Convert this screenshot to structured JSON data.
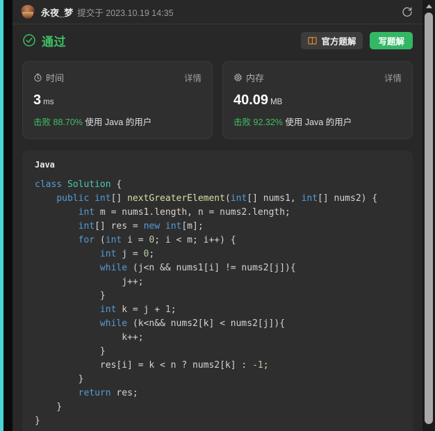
{
  "header": {
    "user_name": "永夜_梦",
    "submit_meta": "提交于 2023.10.19 14:35",
    "refresh_icon": "refresh-icon",
    "avatar_icon": "user-avatar"
  },
  "status": {
    "check_icon": "check-circle-icon",
    "text": "通过",
    "official_button": "官方题解",
    "official_icon": "book-icon",
    "write_button": "写题解",
    "accent_green": "#34b765",
    "status_green": "#3fbf62",
    "book_orange": "#e08b2c"
  },
  "stats": [
    {
      "icon": "clock-icon",
      "label": "时间",
      "detail_link": "详情",
      "value": "3",
      "unit": "ms",
      "beat_prefix": "击败",
      "beat_percent": "88.70%",
      "beat_suffix": "使用 Java 的用户"
    },
    {
      "icon": "memory-chip-icon",
      "label": "内存",
      "detail_link": "详情",
      "value": "40.09",
      "unit": "MB",
      "beat_prefix": "击败",
      "beat_percent": "92.32%",
      "beat_suffix": "使用 Java 的用户"
    }
  ],
  "code": {
    "language_label": "Java",
    "lines": [
      [
        [
          "k",
          "class "
        ],
        [
          "ty",
          "Solution"
        ],
        [
          "pl",
          " {"
        ]
      ],
      [
        [
          "pl",
          "    "
        ],
        [
          "k",
          "public "
        ],
        [
          "k",
          "int"
        ],
        [
          "pl",
          "[] "
        ],
        [
          "fn",
          "nextGreaterElement"
        ],
        [
          "pl",
          "("
        ],
        [
          "k",
          "int"
        ],
        [
          "pl",
          "[] nums1, "
        ],
        [
          "k",
          "int"
        ],
        [
          "pl",
          "[] nums2) {"
        ]
      ],
      [
        [
          "pl",
          "        "
        ],
        [
          "k",
          "int"
        ],
        [
          "pl",
          " m = nums1.length, n = nums2.length;"
        ]
      ],
      [
        [
          "pl",
          "        "
        ],
        [
          "k",
          "int"
        ],
        [
          "pl",
          "[] res = "
        ],
        [
          "k",
          "new "
        ],
        [
          "k",
          "int"
        ],
        [
          "pl",
          "[m];"
        ]
      ],
      [
        [
          "pl",
          "        "
        ],
        [
          "k",
          "for"
        ],
        [
          "pl",
          " ("
        ],
        [
          "k",
          "int"
        ],
        [
          "pl",
          " i = "
        ],
        [
          "nu",
          "0"
        ],
        [
          "pl",
          "; i < m; i++) {"
        ]
      ],
      [
        [
          "pl",
          "            "
        ],
        [
          "k",
          "int"
        ],
        [
          "pl",
          " j = "
        ],
        [
          "nu",
          "0"
        ],
        [
          "pl",
          ";"
        ]
      ],
      [
        [
          "pl",
          "            "
        ],
        [
          "k",
          "while"
        ],
        [
          "pl",
          " (j<n && nums1[i] != nums2[j]){"
        ]
      ],
      [
        [
          "pl",
          "                j++;"
        ]
      ],
      [
        [
          "pl",
          "            }"
        ]
      ],
      [
        [
          "pl",
          "            "
        ],
        [
          "k",
          "int"
        ],
        [
          "pl",
          " k = j + "
        ],
        [
          "nu",
          "1"
        ],
        [
          "pl",
          ";"
        ]
      ],
      [
        [
          "pl",
          "            "
        ],
        [
          "k",
          "while"
        ],
        [
          "pl",
          " (k<n&& nums2[k] < nums2[j]){"
        ]
      ],
      [
        [
          "pl",
          "                k++;"
        ]
      ],
      [
        [
          "pl",
          "            }"
        ]
      ],
      [
        [
          "pl",
          "            res[i] = k < n ? nums2[k] : "
        ],
        [
          "nu",
          "-1"
        ],
        [
          "pl",
          ";"
        ]
      ],
      [
        [
          "pl",
          "        }"
        ]
      ],
      [
        [
          "pl",
          "        "
        ],
        [
          "k",
          "return"
        ],
        [
          "pl",
          " res;"
        ]
      ],
      [
        [
          "pl",
          "    }"
        ]
      ],
      [
        [
          "pl",
          "}"
        ]
      ]
    ]
  },
  "scrollbar": {
    "up_arrow_icon": "scroll-up-arrow-icon"
  }
}
